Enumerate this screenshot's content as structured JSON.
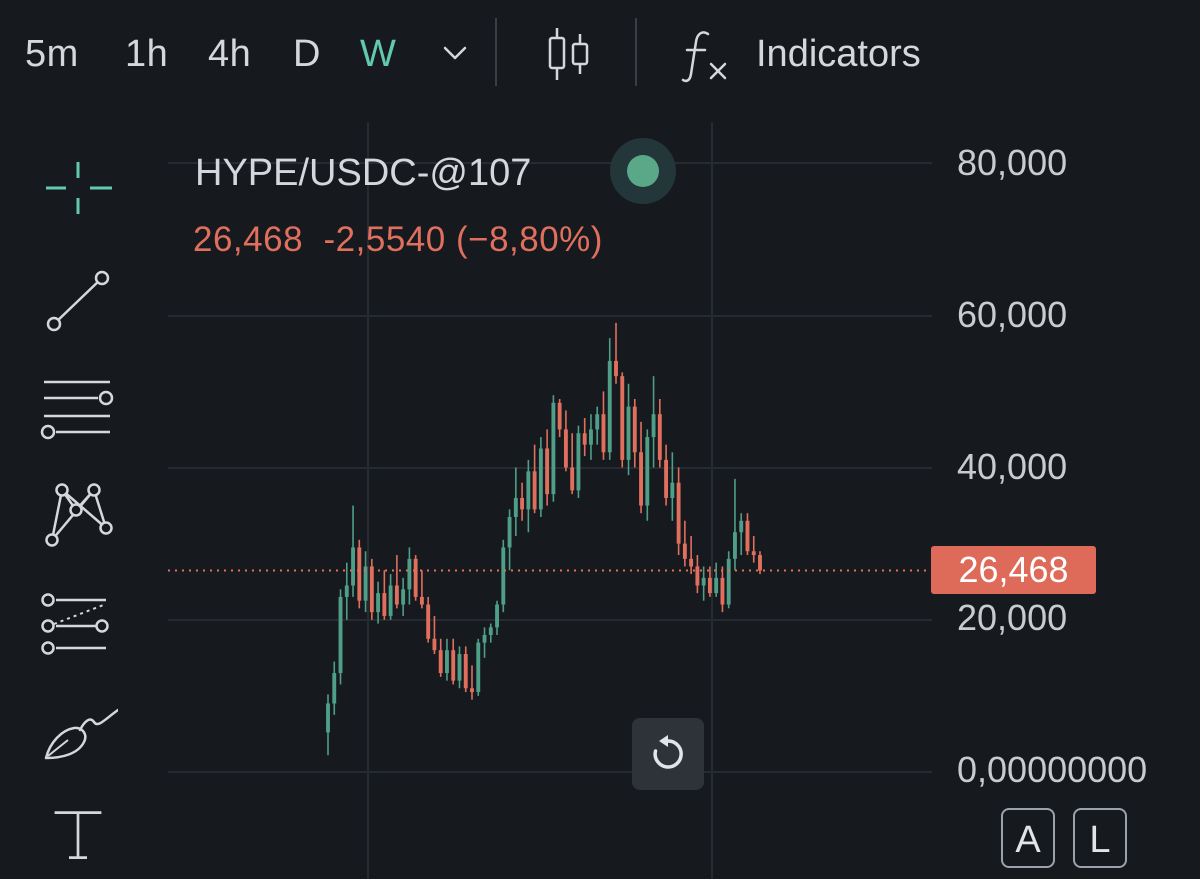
{
  "toolbar": {
    "timeframes": [
      "5m",
      "1h",
      "4h",
      "D",
      "W"
    ],
    "active_timeframe": "W",
    "indicators_label": "Indicators"
  },
  "tools": [
    "crosshair-icon",
    "trend-line-icon",
    "horizontal-lines-icon",
    "pattern-icon",
    "fib-retracement-icon",
    "brush-icon",
    "text-icon"
  ],
  "legend": {
    "symbol": "HYPE/USDC-@107",
    "last": "26,468",
    "change": "-2,5540",
    "change_pct": "(−8,80%)"
  },
  "colors": {
    "up": "#4f9e87",
    "down": "#e06f5e",
    "background": "#161a1e",
    "accent": "#62c8b0"
  },
  "y_axis": {
    "ticks": [
      "80,000",
      "60,000",
      "40,000",
      "20,000",
      "0,00000000"
    ],
    "current_price_tag": "26,468"
  },
  "scale_buttons": {
    "auto": "A",
    "log": "L"
  },
  "chart_data": {
    "type": "candlestick",
    "symbol": "HYPE/USDC-@107",
    "interval": "W",
    "ylim": [
      0,
      80
    ],
    "current_price": 26.468,
    "ohlc": [
      [
        5.2,
        10.2,
        2.2,
        9.0
      ],
      [
        9.0,
        14.5,
        7.5,
        13.0
      ],
      [
        13.0,
        24.0,
        11.5,
        23.0
      ],
      [
        23.0,
        27.5,
        20.0,
        24.5
      ],
      [
        24.5,
        35.0,
        23.0,
        29.5
      ],
      [
        29.5,
        30.5,
        21.5,
        22.5
      ],
      [
        22.5,
        29.0,
        21.0,
        27.0
      ],
      [
        27.0,
        28.0,
        20.0,
        21.0
      ],
      [
        21.0,
        25.0,
        19.5,
        23.5
      ],
      [
        23.5,
        26.5,
        20.0,
        20.5
      ],
      [
        20.5,
        26.0,
        20.0,
        24.5
      ],
      [
        24.5,
        28.5,
        21.5,
        22.0
      ],
      [
        22.0,
        25.5,
        20.5,
        24.0
      ],
      [
        24.0,
        29.5,
        22.0,
        28.0
      ],
      [
        28.0,
        28.5,
        22.5,
        23.0
      ],
      [
        23.0,
        26.5,
        21.5,
        22.0
      ],
      [
        22.0,
        23.0,
        17.0,
        17.5
      ],
      [
        17.5,
        20.5,
        15.5,
        16.0
      ],
      [
        16.0,
        17.5,
        12.5,
        13.0
      ],
      [
        13.0,
        17.5,
        12.0,
        16.0
      ],
      [
        16.0,
        17.5,
        11.5,
        12.0
      ],
      [
        12.0,
        16.5,
        11.0,
        15.5
      ],
      [
        15.5,
        16.5,
        10.5,
        11.0
      ],
      [
        11.0,
        14.0,
        9.5,
        10.5
      ],
      [
        10.5,
        17.5,
        10.0,
        17.0
      ],
      [
        17.0,
        19.0,
        15.0,
        18.0
      ],
      [
        18.0,
        19.5,
        17.0,
        19.0
      ],
      [
        19.0,
        22.5,
        18.0,
        22.0
      ],
      [
        22.0,
        30.5,
        21.0,
        29.5
      ],
      [
        29.5,
        34.5,
        26.5,
        33.5
      ],
      [
        33.5,
        40.0,
        31.0,
        36.0
      ],
      [
        36.0,
        38.0,
        33.0,
        34.5
      ],
      [
        34.5,
        41.0,
        31.5,
        39.5
      ],
      [
        39.5,
        43.0,
        34.0,
        34.5
      ],
      [
        34.5,
        44.0,
        33.5,
        42.5
      ],
      [
        42.5,
        45.0,
        35.0,
        36.5
      ],
      [
        36.5,
        49.5,
        35.5,
        48.5
      ],
      [
        48.5,
        49.0,
        44.0,
        45.0
      ],
      [
        45.0,
        47.5,
        39.5,
        40.0
      ],
      [
        40.0,
        44.5,
        36.5,
        37.0
      ],
      [
        37.0,
        45.5,
        36.0,
        44.5
      ],
      [
        44.5,
        46.5,
        41.5,
        43.0
      ],
      [
        43.0,
        47.0,
        41.0,
        45.0
      ],
      [
        45.0,
        48.0,
        43.0,
        47.0
      ],
      [
        47.0,
        50.0,
        41.0,
        42.0
      ],
      [
        42.0,
        57.0,
        41.0,
        54.0
      ],
      [
        54.0,
        59.0,
        51.0,
        52.0
      ],
      [
        52.0,
        52.5,
        40.0,
        41.0
      ],
      [
        41.0,
        51.0,
        39.0,
        48.0
      ],
      [
        48.0,
        49.0,
        40.0,
        42.0
      ],
      [
        42.0,
        46.0,
        34.0,
        35.0
      ],
      [
        35.0,
        45.0,
        33.0,
        44.0
      ],
      [
        44.0,
        52.0,
        40.0,
        47.0
      ],
      [
        47.0,
        49.0,
        40.0,
        41.0
      ],
      [
        41.0,
        43.0,
        35.0,
        36.0
      ],
      [
        36.0,
        42.0,
        33.0,
        38.0
      ],
      [
        38.0,
        40.0,
        28.5,
        30.0
      ],
      [
        30.0,
        33.0,
        27.0,
        28.0
      ],
      [
        28.0,
        31.0,
        26.0,
        27.0
      ],
      [
        27.0,
        28.5,
        23.5,
        24.5
      ],
      [
        24.5,
        27.0,
        22.5,
        25.5
      ],
      [
        25.5,
        27.0,
        23.0,
        23.5
      ],
      [
        23.5,
        27.5,
        23.0,
        25.5
      ],
      [
        25.5,
        27.0,
        21.0,
        22.0
      ],
      [
        22.0,
        29.0,
        21.5,
        28.0
      ],
      [
        28.0,
        38.5,
        26.5,
        31.5
      ],
      [
        31.5,
        34.0,
        28.5,
        33.0
      ],
      [
        33.0,
        34.0,
        28.5,
        29.0
      ],
      [
        29.0,
        31.0,
        27.5,
        28.5
      ],
      [
        28.5,
        29.0,
        26.0,
        26.468
      ]
    ]
  }
}
